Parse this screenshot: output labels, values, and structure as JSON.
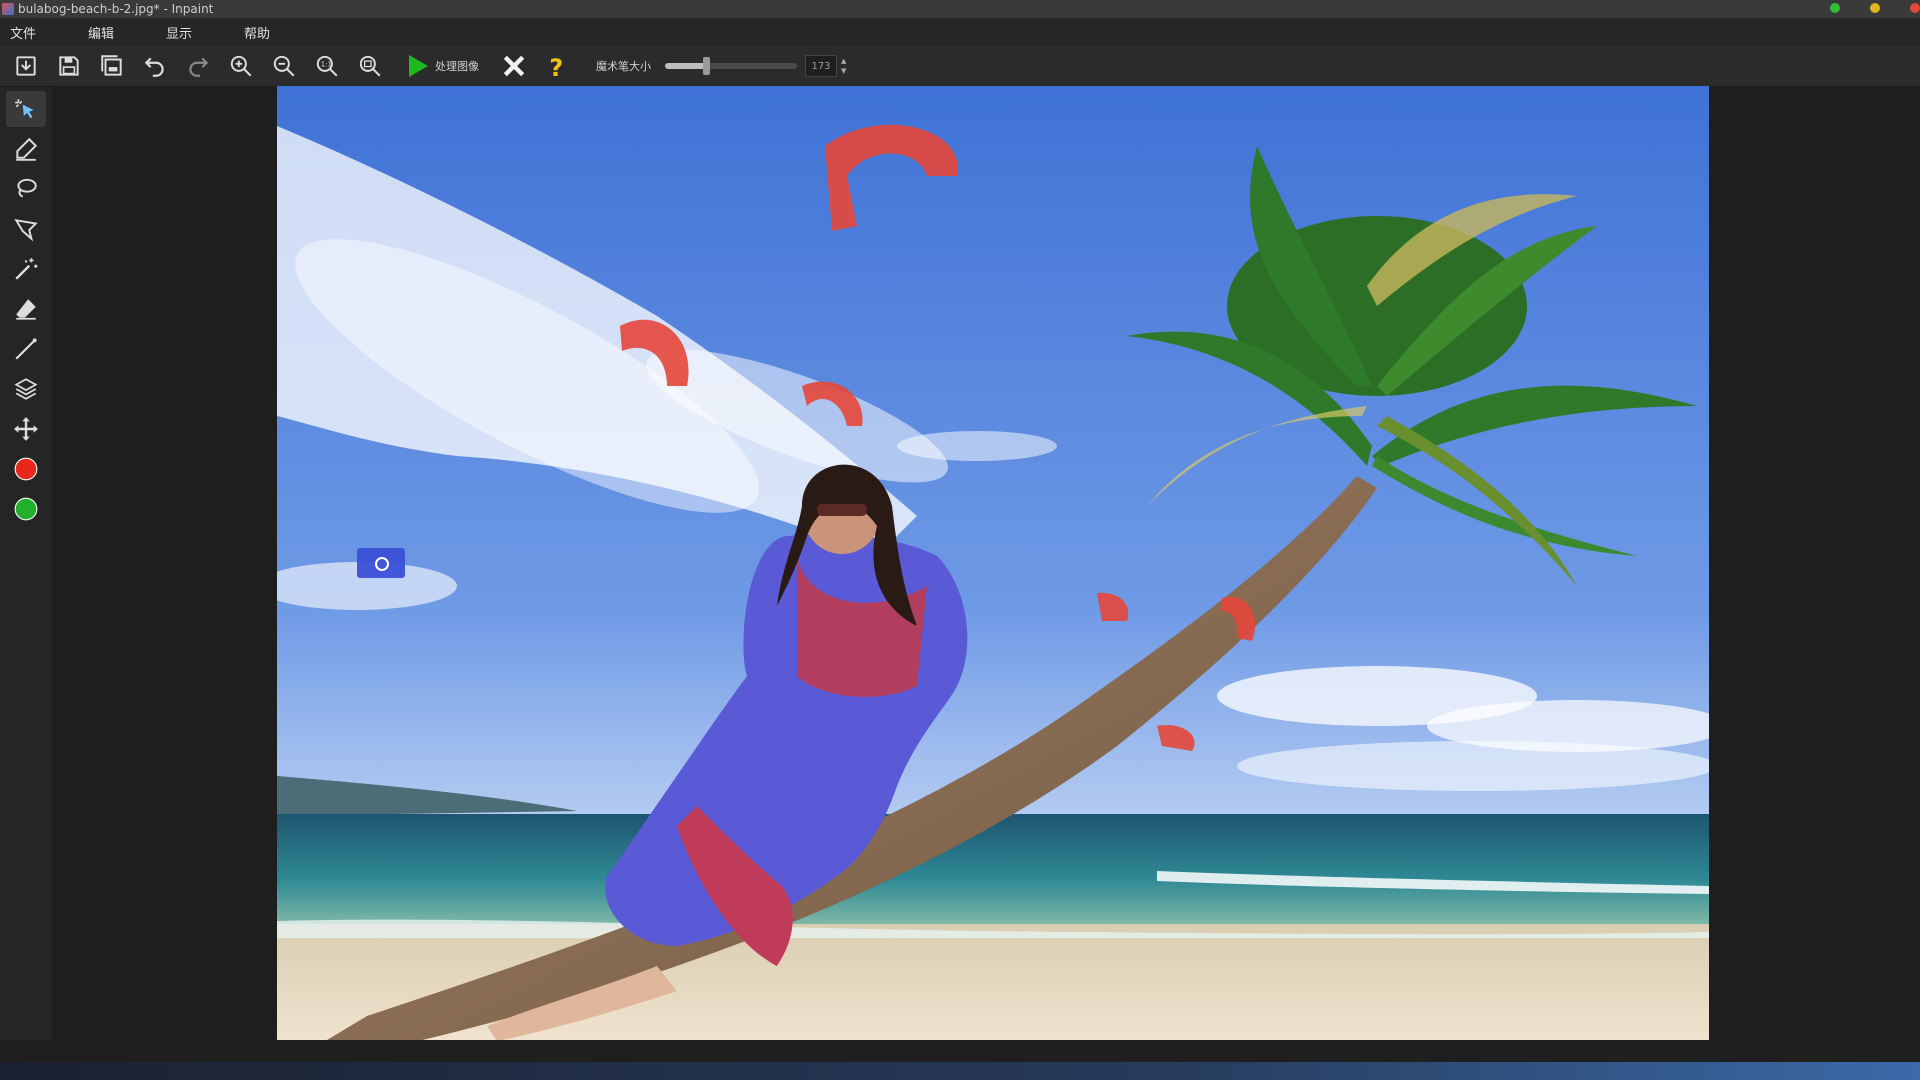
{
  "window": {
    "title": "bulabog-beach-b-2.jpg* - Inpaint"
  },
  "menu": [
    "文件",
    "编辑",
    "显示",
    "帮助"
  ],
  "toolbar": {
    "buttons": [
      "open-icon",
      "save-icon",
      "save-as-icon",
      "undo-icon",
      "redo-icon",
      "zoom-in-icon",
      "zoom-out-icon",
      "zoom-actual-icon",
      "zoom-fit-icon"
    ],
    "run_label": "处理图像",
    "slider_label": "魔术笔大小",
    "marker_size": "173",
    "marker_size_fraction": 0.31
  },
  "tools": [
    "smart-select-icon",
    "marker-icon",
    "lasso-icon",
    "polygon-lasso-icon",
    "magic-wand-icon",
    "eraser-icon",
    "line-icon",
    "layers-icon",
    "move-icon",
    "red-mode-icon",
    "green-mode-icon"
  ],
  "colors": {
    "mask": "#e5473a",
    "accent_green": "#1db91d",
    "help": "#f0c419"
  }
}
